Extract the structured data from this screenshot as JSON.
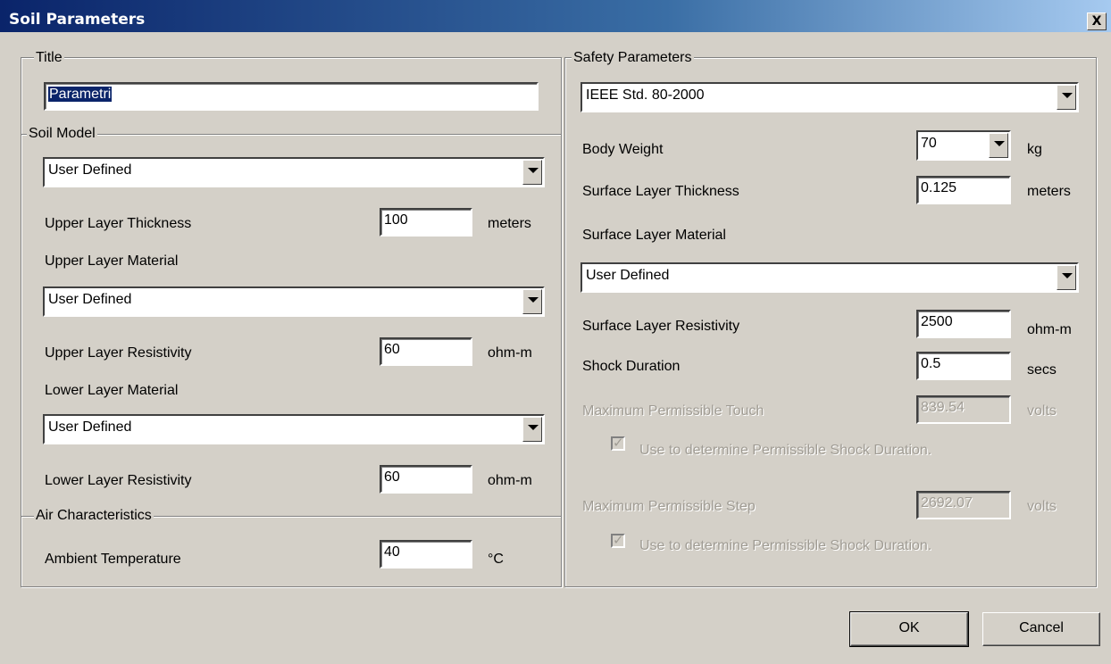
{
  "window": {
    "title": "Soil Parameters",
    "close_glyph": "X"
  },
  "left": {
    "title_group": {
      "legend": "Title",
      "value": "Parametri"
    },
    "soil_model": {
      "legend": "Soil Model",
      "model_select": "User Defined",
      "upper_thickness": {
        "label": "Upper Layer Thickness",
        "value": "100",
        "unit": "meters"
      },
      "upper_material": {
        "label": "Upper Layer Material",
        "value": "User Defined"
      },
      "upper_resistivity": {
        "label": "Upper Layer Resistivity",
        "value": "60",
        "unit": "ohm-m"
      },
      "lower_material": {
        "label": "Lower Layer Material",
        "value": "User Defined"
      },
      "lower_resistivity": {
        "label": "Lower Layer Resistivity",
        "value": "60",
        "unit": "ohm-m"
      }
    },
    "air": {
      "legend": "Air Characteristics",
      "ambient_temperature": {
        "label": "Ambient Temperature",
        "value": "40",
        "unit": "°C"
      }
    }
  },
  "right": {
    "legend": "Safety Parameters",
    "standard_select": "IEEE Std. 80-2000",
    "body_weight": {
      "label": "Body Weight",
      "value": "70",
      "unit": "kg"
    },
    "surface_thickness": {
      "label": "Surface Layer Thickness",
      "value": "0.125",
      "unit": "meters"
    },
    "surface_material": {
      "label": "Surface Layer Material",
      "value": "User Defined"
    },
    "surface_resistivity": {
      "label": "Surface Layer Resistivity",
      "value": "2500",
      "unit": "ohm-m"
    },
    "shock_duration": {
      "label": "Shock Duration",
      "value": "0.5",
      "unit": "secs"
    },
    "max_touch": {
      "label": "Maximum Permissible Touch",
      "value": "839.54",
      "unit": "volts"
    },
    "touch_checkbox": {
      "label": "Use to determine Permissible Shock Duration.",
      "checked": true,
      "enabled": false
    },
    "max_step": {
      "label": "Maximum Permissible Step",
      "value": "2692.07",
      "unit": "volts"
    },
    "step_checkbox": {
      "label": "Use to determine Permissible Shock Duration.",
      "checked": true,
      "enabled": false
    }
  },
  "buttons": {
    "ok": "OK",
    "cancel": "Cancel"
  },
  "icons": {
    "close": "close-icon",
    "dropdown": "chevron-down-icon",
    "check": "checkmark-icon"
  }
}
